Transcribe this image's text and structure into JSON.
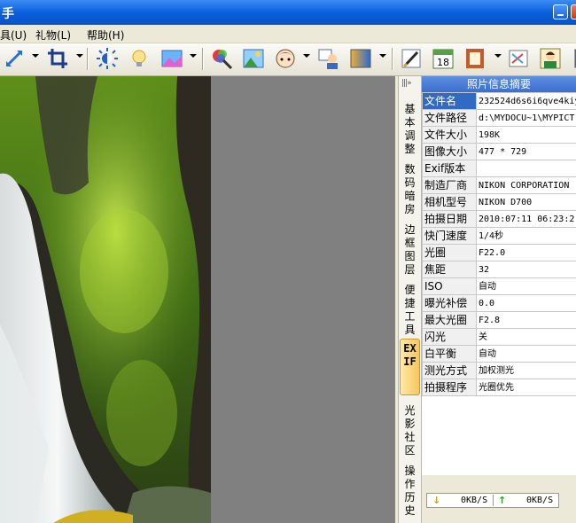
{
  "window": {
    "title": "手"
  },
  "menu": [
    {
      "label": "具(U)"
    },
    {
      "label": "礼物(L)"
    },
    {
      "label": "帮助(H)"
    }
  ],
  "toolbar": {
    "icons": [
      "rotate-icon",
      "crop-icon",
      "brightness-icon",
      "light-bulb-icon",
      "image-color-icon",
      "color-picker-icon",
      "landscape-icon",
      "face-icon",
      "people-icon",
      "gradient-icon",
      "brush-icon",
      "calendar-icon",
      "frame-icon",
      "eraser-icon",
      "person-photo-icon"
    ],
    "calendar_day": "18"
  },
  "tabs": [
    {
      "label": "基本调整"
    },
    {
      "label": "数码暗房"
    },
    {
      "label": "边框图层"
    },
    {
      "label": "便捷工具"
    },
    {
      "label": "EXIF"
    },
    {
      "label": "光影社区"
    },
    {
      "label": "操作历史"
    }
  ],
  "tabs_collapse": "|||»",
  "panel": {
    "title": "照片信息摘要",
    "rows": [
      {
        "key": "文件名",
        "value": "232524d6s6i6qve4kiy"
      },
      {
        "key": "文件路径",
        "value": "d:\\MYDOCU~1\\MYPICT"
      },
      {
        "key": "文件大小",
        "value": "198K"
      },
      {
        "key": "图像大小",
        "value": "477 * 729"
      },
      {
        "key": "Exif版本",
        "value": ""
      },
      {
        "key": "制造厂商",
        "value": "NIKON CORPORATION"
      },
      {
        "key": "相机型号",
        "value": "NIKON D700"
      },
      {
        "key": "拍摄日期",
        "value": "2010:07:11 06:23:2"
      },
      {
        "key": "快门速度",
        "value": "1/4秒"
      },
      {
        "key": "光圈",
        "value": "F22.0"
      },
      {
        "key": "焦距",
        "value": "32"
      },
      {
        "key": "ISO",
        "value": "自动"
      },
      {
        "key": "曝光补偿",
        "value": "0.0"
      },
      {
        "key": "最大光圈",
        "value": "F2.8"
      },
      {
        "key": "闪光",
        "value": "关"
      },
      {
        "key": "白平衡",
        "value": "自动"
      },
      {
        "key": "测光方式",
        "value": "加权测光"
      },
      {
        "key": "拍摄程序",
        "value": "光圈优先"
      }
    ]
  },
  "speed": {
    "down": "0KB/S",
    "up": "0KB/S"
  },
  "colors": {
    "title_blue": "#0a5fdc",
    "selected_row": "#316ac5",
    "active_tab": "#f7c75a",
    "canvas_gray": "#808080"
  }
}
